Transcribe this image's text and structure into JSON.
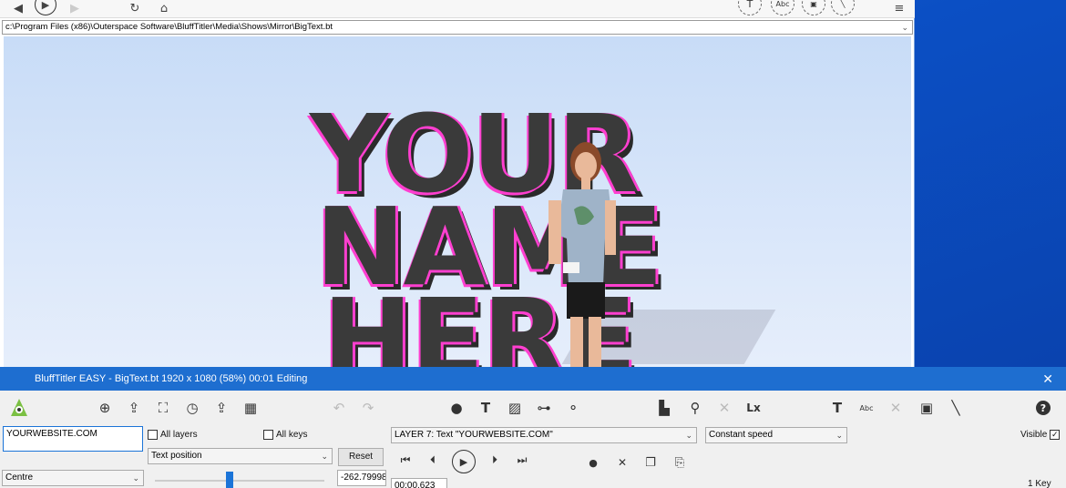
{
  "toolbar": {
    "back_icon": "arrow-left-icon",
    "play_icon": "play-circle-icon",
    "forward_icon": "arrow-right-icon",
    "refresh_icon": "refresh-icon",
    "home_icon": "home-icon",
    "t_label": "T",
    "abc_label": "Abc",
    "menu_icon": "hamburger-icon"
  },
  "path_bar": {
    "value": "c:\\Program Files (x86)\\Outerspace Software\\BluffTitler\\Media\\Shows\\Mirror\\BigText.bt"
  },
  "preview": {
    "words": [
      "YOUR",
      "NAME",
      "HERE"
    ],
    "accent_color": "#ff3fd0",
    "letter_fill": "#0d9be0"
  },
  "panel": {
    "title": "BluffTitler EASY  - BigText.bt 1920 x 1080 (58%) 00:01 Editing",
    "close": "✕",
    "text_value": "YOURWEBSITE.COM",
    "all_layers": "All layers",
    "all_keys": "All keys",
    "property": "Text position",
    "reset": "Reset",
    "alignment": "Centre",
    "slider_value": "-262.79998",
    "layer": "LAYER 7: Text \"YOURWEBSITE.COM\"",
    "speed": "Constant speed",
    "visible": "Visible",
    "time": "00:00.623",
    "keys": "1 Key"
  }
}
